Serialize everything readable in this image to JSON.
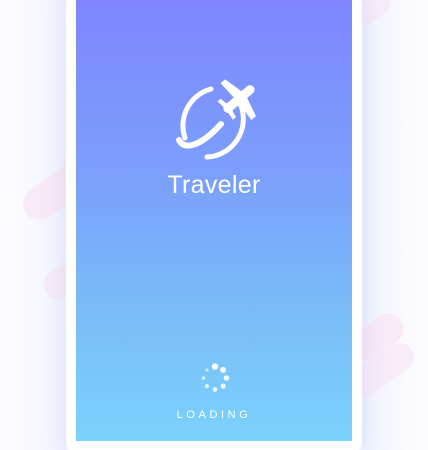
{
  "app": {
    "name": "Traveler",
    "logo_icon": "airplane-orbit-icon"
  },
  "loading": {
    "label": "LOADING",
    "spinner_icon": "loading-spinner-icon"
  },
  "colors": {
    "gradient_top": "#7f86fe",
    "gradient_bottom": "#7bd2fa",
    "text": "#ffffff",
    "decoration_pink": "#f8e8f6"
  }
}
